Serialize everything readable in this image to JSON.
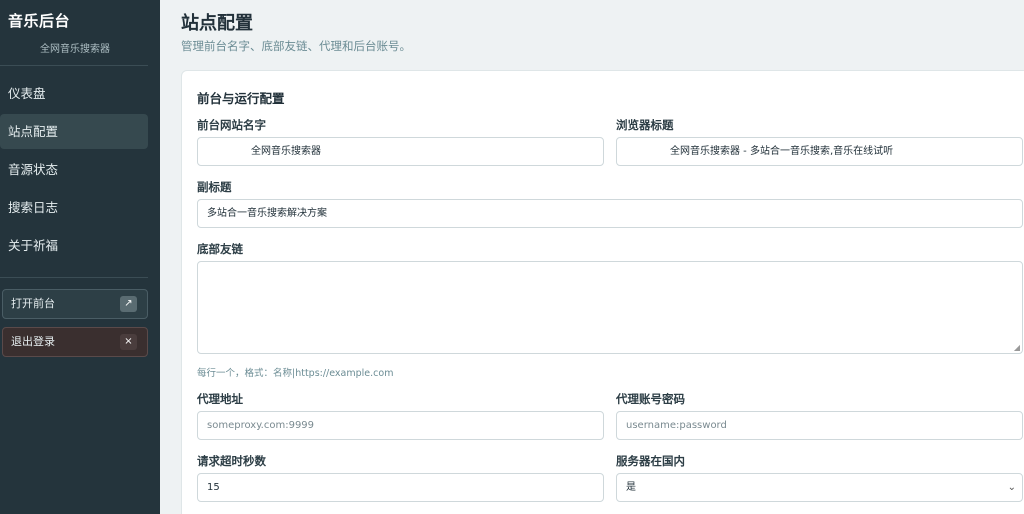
{
  "sidebar": {
    "brand_title": "音乐后台",
    "brand_sub": "全网音乐搜索器",
    "items": [
      {
        "label": "仪表盘"
      },
      {
        "label": "站点配置"
      },
      {
        "label": "音源状态"
      },
      {
        "label": "搜索日志"
      },
      {
        "label": "关于祈福"
      }
    ],
    "open_front": "打开前台",
    "open_front_icon": "↗",
    "logout": "退出登录",
    "logout_icon": "×"
  },
  "page": {
    "title": "站点配置",
    "desc": "管理前台名字、底部友链、代理和后台账号。"
  },
  "card": {
    "title": "前台与运行配置",
    "site_name_label": "前台网站名字",
    "site_name_value": "全网音乐搜索器",
    "browser_title_label": "浏览器标题",
    "browser_title_value": "全网音乐搜索器 - 多站合一音乐搜索,音乐在线试听",
    "subtitle_label": "副标题",
    "subtitle_value": "多站合一音乐搜索解决方案",
    "footer_links_label": "底部友链",
    "footer_links_hint": "每行一个，格式：名称|https://example.com",
    "proxy_label": "代理地址",
    "proxy_placeholder": "someproxy.com:9999",
    "proxy_auth_label": "代理账号密码",
    "proxy_auth_placeholder": "username:password",
    "timeout_label": "请求超时秒数",
    "timeout_value": "15",
    "domestic_label": "服务器在国内",
    "domestic_value": "是"
  }
}
